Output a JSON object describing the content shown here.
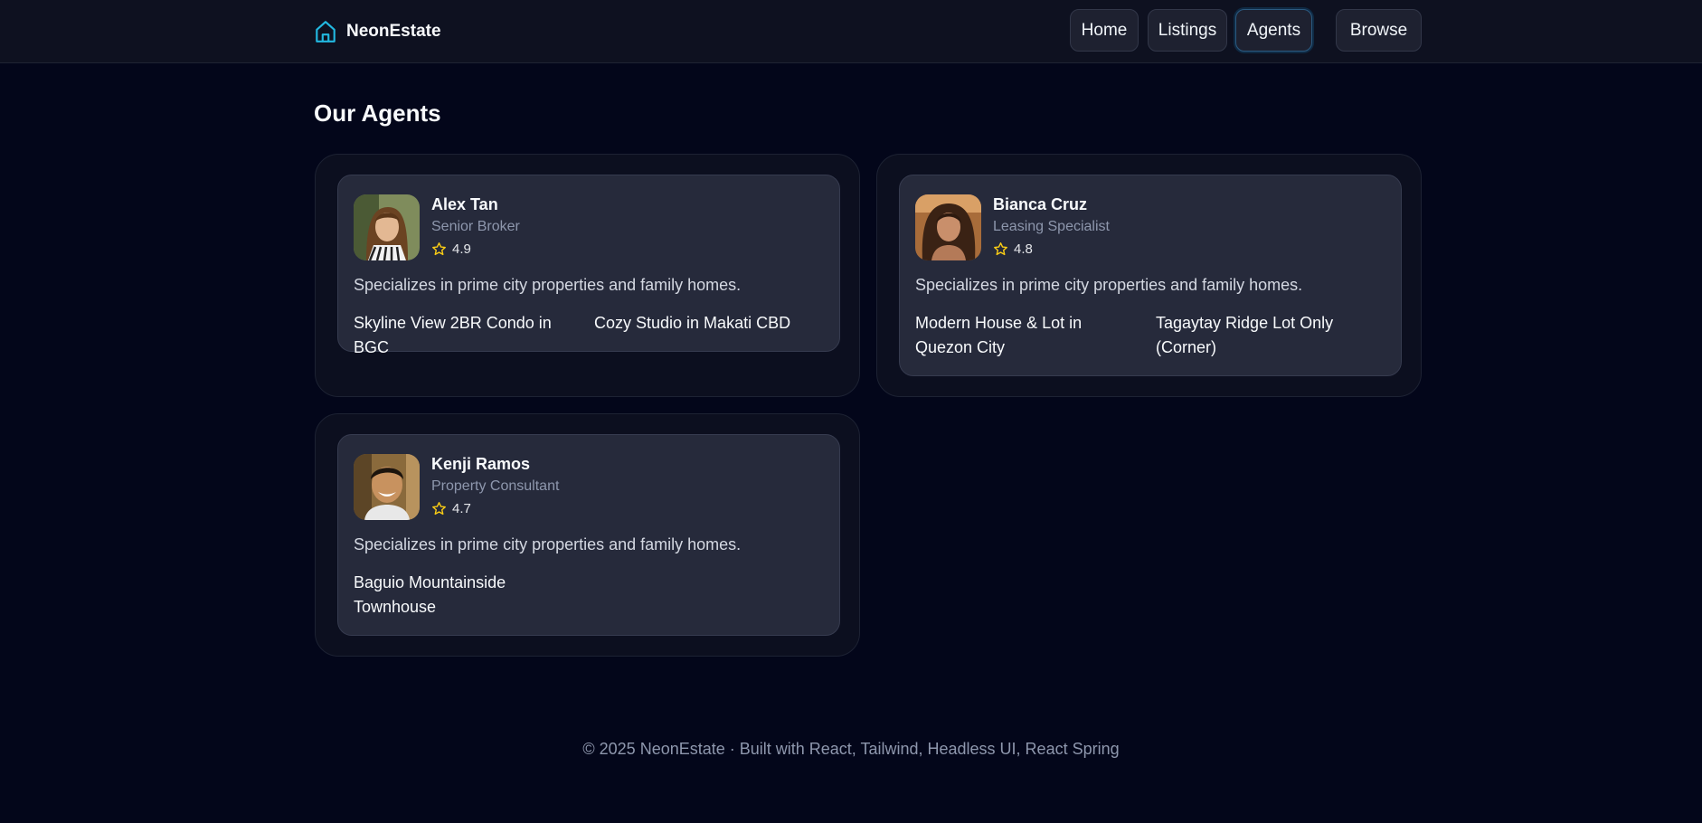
{
  "header": {
    "brand": "NeonEstate",
    "brand_icon": "home-icon",
    "nav": [
      {
        "label": "Home",
        "active": false
      },
      {
        "label": "Listings",
        "active": false
      },
      {
        "label": "Agents",
        "active": true
      },
      {
        "label": "Browse",
        "active": false
      }
    ]
  },
  "main": {
    "title": "Our Agents",
    "agents": [
      {
        "name": "Alex Tan",
        "role": "Senior Broker",
        "rating": "4.9",
        "description": "Specializes in prime city properties and family homes.",
        "listings": [
          "Skyline View 2BR Condo in BGC",
          "Cozy Studio in Makati CBD"
        ]
      },
      {
        "name": "Bianca Cruz",
        "role": "Leasing Specialist",
        "rating": "4.8",
        "description": "Specializes in prime city properties and family homes.",
        "listings": [
          "Modern House & Lot in Quezon City",
          "Tagaytay Ridge Lot Only (Corner)"
        ]
      },
      {
        "name": "Kenji Ramos",
        "role": "Property Consultant",
        "rating": "4.7",
        "description": "Specializes in prime city properties and family homes.",
        "listings": [
          "Baguio Mountainside Townhouse"
        ]
      }
    ]
  },
  "footer": {
    "text": "© 2025 NeonEstate · Built with React, Tailwind, Headless UI, React Spring"
  },
  "colors": {
    "background": "#03061a",
    "accent": "#22b8e0",
    "star": "#facc15",
    "card": "#262a3b"
  }
}
